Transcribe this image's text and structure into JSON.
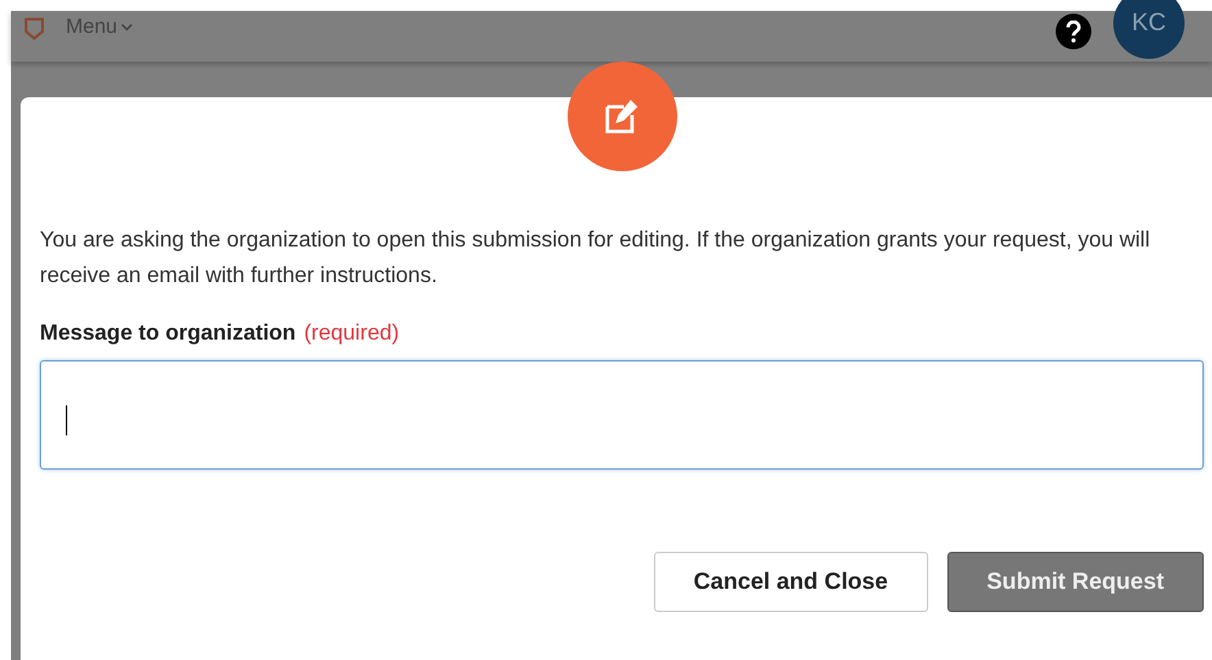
{
  "header": {
    "menu_label": "Menu",
    "avatar_initials": "KC"
  },
  "dialog": {
    "description": "You are asking the organization to open this submission for editing. If the organization grants your request, you will receive an email with further instructions.",
    "field": {
      "label": "Message to organization",
      "required_note": "(required)",
      "focused": true
    },
    "buttons": [
      {
        "label": "Cancel and Close",
        "kind": "secondary",
        "disabled": false
      },
      {
        "label": "Submit Request",
        "kind": "primary",
        "disabled": true
      }
    ]
  }
}
